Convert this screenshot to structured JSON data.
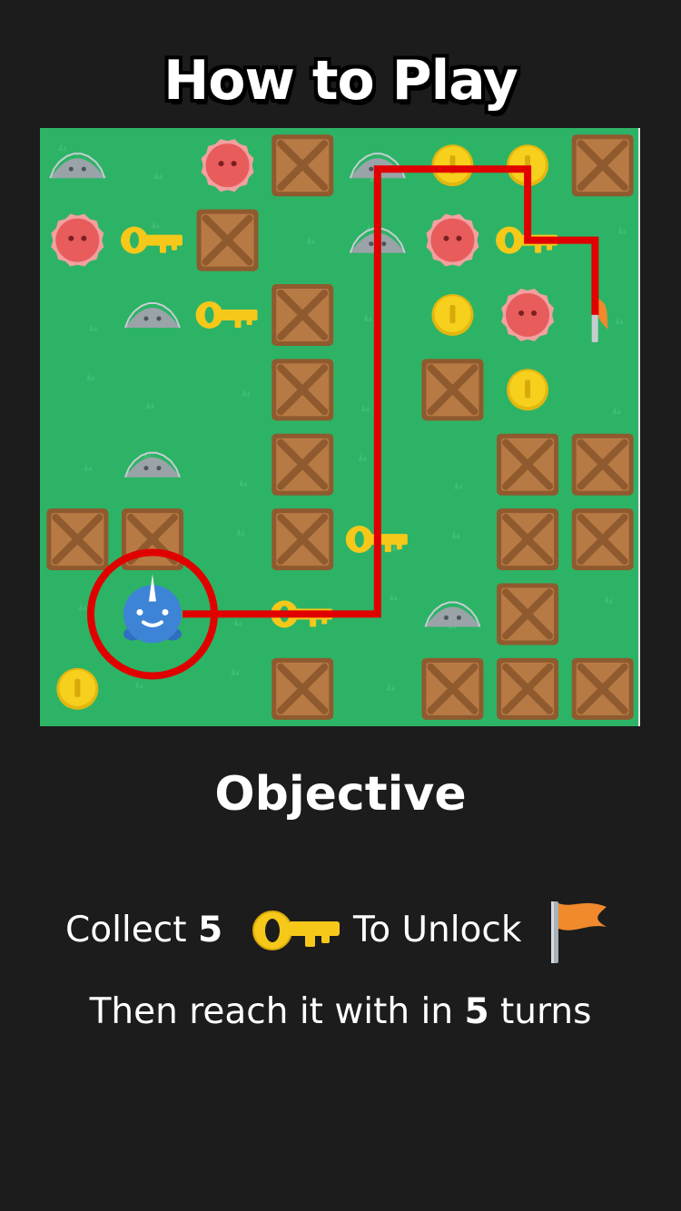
{
  "header": {
    "title": "How to Play"
  },
  "board": {
    "cols": 8,
    "rows": 8,
    "colors": {
      "grass": "#2db366",
      "crate": "#b87a45",
      "crate_dark": "#8f5a2e",
      "coin": "#f7cf1d",
      "key": "#f5c81a",
      "blob": "#e85c5c",
      "rock": "#9aa3a8",
      "player": "#3e84d6",
      "path": "#e00000",
      "flag": "#f08a2c"
    },
    "tiles": [
      {
        "type": "rock",
        "col": 0,
        "row": 0
      },
      {
        "type": "blob",
        "col": 2,
        "row": 0
      },
      {
        "type": "crate",
        "col": 3,
        "row": 0
      },
      {
        "type": "rock",
        "col": 4,
        "row": 0
      },
      {
        "type": "coin",
        "col": 5,
        "row": 0
      },
      {
        "type": "coin",
        "col": 6,
        "row": 0
      },
      {
        "type": "crate",
        "col": 7,
        "row": 0
      },
      {
        "type": "blob",
        "col": 0,
        "row": 1
      },
      {
        "type": "key",
        "col": 1,
        "row": 1
      },
      {
        "type": "crate",
        "col": 2,
        "row": 1
      },
      {
        "type": "rock",
        "col": 4,
        "row": 1
      },
      {
        "type": "blob",
        "col": 5,
        "row": 1
      },
      {
        "type": "key",
        "col": 6,
        "row": 1
      },
      {
        "type": "key",
        "col": 2,
        "row": 2
      },
      {
        "type": "rock",
        "col": 1,
        "row": 2
      },
      {
        "type": "crate",
        "col": 3,
        "row": 2
      },
      {
        "type": "coin",
        "col": 5,
        "row": 2
      },
      {
        "type": "blob",
        "col": 6,
        "row": 2
      },
      {
        "type": "flag",
        "col": 7,
        "row": 2
      },
      {
        "type": "crate",
        "col": 3,
        "row": 3
      },
      {
        "type": "crate",
        "col": 5,
        "row": 3
      },
      {
        "type": "coin",
        "col": 6,
        "row": 3
      },
      {
        "type": "rock",
        "col": 1,
        "row": 4
      },
      {
        "type": "crate",
        "col": 3,
        "row": 4
      },
      {
        "type": "crate",
        "col": 6,
        "row": 4
      },
      {
        "type": "crate",
        "col": 7,
        "row": 4
      },
      {
        "type": "crate",
        "col": 0,
        "row": 5
      },
      {
        "type": "crate",
        "col": 1,
        "row": 5
      },
      {
        "type": "crate",
        "col": 3,
        "row": 5
      },
      {
        "type": "key",
        "col": 4,
        "row": 5
      },
      {
        "type": "crate",
        "col": 6,
        "row": 5
      },
      {
        "type": "crate",
        "col": 7,
        "row": 5
      },
      {
        "type": "player",
        "col": 1,
        "row": 6
      },
      {
        "type": "key",
        "col": 3,
        "row": 6
      },
      {
        "type": "rock",
        "col": 5,
        "row": 6
      },
      {
        "type": "crate",
        "col": 6,
        "row": 6
      },
      {
        "type": "coin",
        "col": 0,
        "row": 7
      },
      {
        "type": "crate",
        "col": 3,
        "row": 7
      },
      {
        "type": "crate",
        "col": 5,
        "row": 7
      },
      {
        "type": "crate",
        "col": 6,
        "row": 7
      },
      {
        "type": "crate",
        "col": 7,
        "row": 7
      }
    ],
    "path": [
      [
        1.9,
        6.5
      ],
      [
        4.5,
        6.5
      ],
      [
        4.5,
        0.55
      ],
      [
        6.5,
        0.55
      ],
      [
        6.5,
        1.5
      ],
      [
        7.4,
        1.5
      ],
      [
        7.4,
        2.5
      ]
    ],
    "highlight": {
      "col": 1,
      "row": 6
    }
  },
  "objective": {
    "heading": "Objective",
    "collect": "Collect",
    "key_count": "5",
    "to_unlock": "To Unlock",
    "then_prefix": "Then reach it with in",
    "turn_count": "5",
    "turns_suffix": "turns",
    "key_icon": "key-icon",
    "flag_icon": "flag-icon"
  }
}
